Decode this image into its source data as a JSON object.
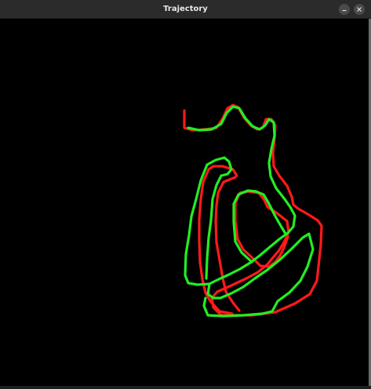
{
  "window": {
    "title": "Trajectory",
    "minimize_icon": "minimize-icon",
    "close_icon": "close-icon"
  },
  "colors": {
    "background": "#000000",
    "titlebar": "#2b2b2b",
    "ground_truth": "#ff1a1a",
    "estimate": "#22ee22"
  },
  "trajectories": [
    {
      "name_icon": "red-trajectory"
    },
    {
      "name_icon": "green-trajectory"
    }
  ]
}
